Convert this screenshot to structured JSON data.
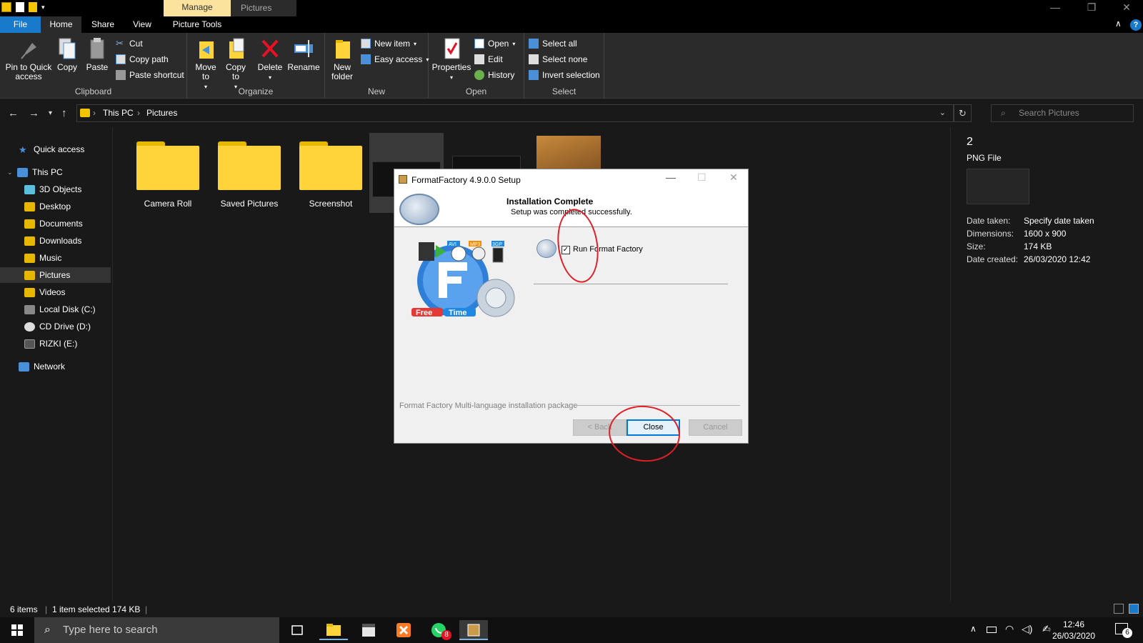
{
  "window": {
    "manage_tab": "Manage",
    "title": "Pictures"
  },
  "ribbon_tabs": [
    "File",
    "Home",
    "Share",
    "View",
    "Picture Tools"
  ],
  "ribbon": {
    "clipboard": {
      "pin": "Pin to Quick access",
      "copy": "Copy",
      "paste": "Paste",
      "cut": "Cut",
      "copy_path": "Copy path",
      "paste_shortcut": "Paste shortcut",
      "label": "Clipboard"
    },
    "organize": {
      "move_to": "Move to",
      "copy_to": "Copy to",
      "delete": "Delete",
      "rename": "Rename",
      "label": "Organize"
    },
    "new": {
      "new_folder": "New folder",
      "new_item": "New item",
      "easy_access": "Easy access",
      "label": "New"
    },
    "open": {
      "properties": "Properties",
      "open": "Open",
      "edit": "Edit",
      "history": "History",
      "label": "Open"
    },
    "select": {
      "select_all": "Select all",
      "select_none": "Select none",
      "invert": "Invert selection",
      "label": "Select"
    }
  },
  "address": {
    "crumbs": [
      "This PC",
      "Pictures"
    ],
    "search_placeholder": "Search Pictures"
  },
  "sidebar": {
    "items": [
      {
        "label": "Quick access",
        "icon": "star-icon"
      },
      {
        "label": "This PC",
        "icon": "computer-icon"
      },
      {
        "label": "3D Objects",
        "icon": "3d-objects-icon"
      },
      {
        "label": "Desktop",
        "icon": "desktop-icon"
      },
      {
        "label": "Documents",
        "icon": "documents-icon"
      },
      {
        "label": "Downloads",
        "icon": "downloads-icon"
      },
      {
        "label": "Music",
        "icon": "music-icon"
      },
      {
        "label": "Pictures",
        "icon": "pictures-icon"
      },
      {
        "label": "Videos",
        "icon": "videos-icon"
      },
      {
        "label": "Local Disk (C:)",
        "icon": "drive-icon"
      },
      {
        "label": "CD Drive (D:)",
        "icon": "cd-icon"
      },
      {
        "label": "RIZKI (E:)",
        "icon": "usb-drive-icon"
      },
      {
        "label": "Network",
        "icon": "network-icon"
      }
    ]
  },
  "files": [
    {
      "label": "Camera Roll"
    },
    {
      "label": "Saved Pictures"
    },
    {
      "label": "Screenshot"
    }
  ],
  "details": {
    "name": "2",
    "type": "PNG File",
    "props": [
      {
        "key": "Date taken:",
        "value": "Specify date taken"
      },
      {
        "key": "Dimensions:",
        "value": "1600 x 900"
      },
      {
        "key": "Size:",
        "value": "174 KB"
      },
      {
        "key": "Date created:",
        "value": "26/03/2020 12:42"
      }
    ]
  },
  "status": {
    "items": "6 items",
    "selected": "1 item selected  174 KB"
  },
  "taskbar": {
    "search_placeholder": "Type here to search",
    "whatsapp_badge": "8",
    "time": "12:46",
    "date": "26/03/2020",
    "notif_count": "6"
  },
  "dialog": {
    "title": "FormatFactory 4.9.0.0 Setup",
    "heading": "Installation Complete",
    "subheading": "Setup was completed successfully.",
    "checkbox_label": "Run Format Factory",
    "checkbox_checked": true,
    "footer": "Format Factory Multi-language installation package",
    "back": "< Back",
    "close": "Close",
    "cancel": "Cancel",
    "logo_text_free": "Free",
    "logo_text_time": "Time",
    "logo_badges": [
      "AVI",
      "MP3",
      "3GP"
    ]
  },
  "colors": {
    "accent": "#1979ca",
    "manage_tab": "#fbe29d",
    "folder": "#ffd43b",
    "annotation": "#e01f26"
  }
}
